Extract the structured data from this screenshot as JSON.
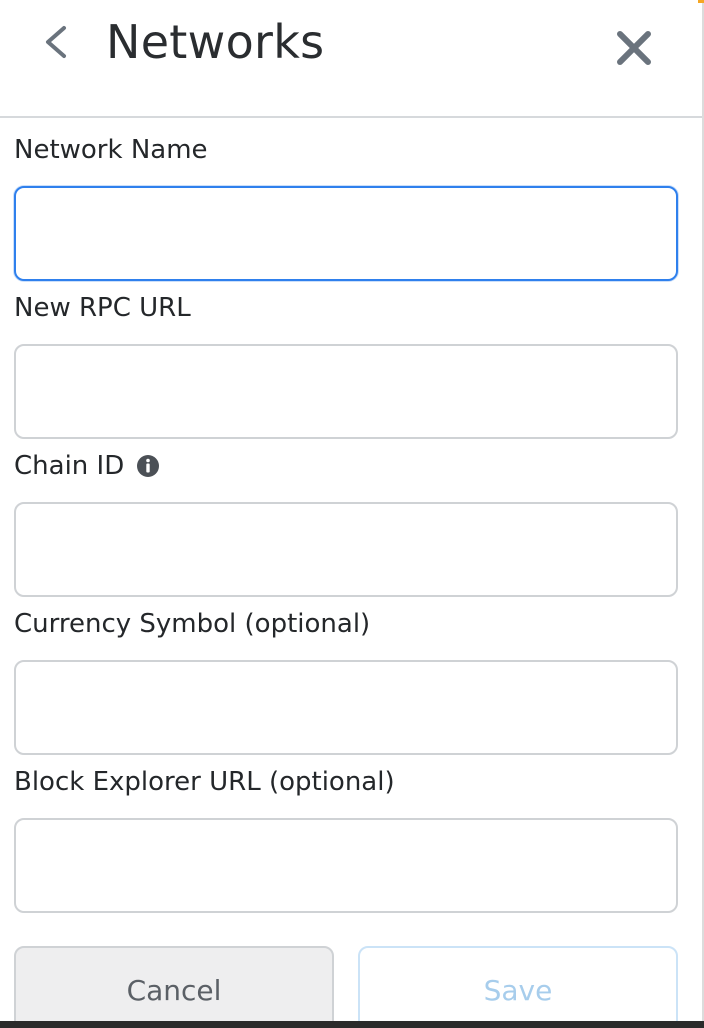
{
  "header": {
    "title": "Networks",
    "back_icon": "chevron-left-icon",
    "close_icon": "close-icon"
  },
  "form": {
    "network_name": {
      "label": "Network Name",
      "value": "",
      "placeholder": ""
    },
    "rpc_url": {
      "label": "New RPC URL",
      "value": "",
      "placeholder": ""
    },
    "chain_id": {
      "label": "Chain ID",
      "value": "",
      "placeholder": "",
      "info_icon": "info-icon"
    },
    "currency_symbol": {
      "label": "Currency Symbol (optional)",
      "value": "",
      "placeholder": ""
    },
    "block_explorer": {
      "label": "Block Explorer URL (optional)",
      "value": "",
      "placeholder": ""
    }
  },
  "actions": {
    "cancel_label": "Cancel",
    "save_label": "Save"
  },
  "colors": {
    "focus_border": "#2f80ed",
    "save_text_disabled": "#a7cdec",
    "cancel_bg": "#eeeeef"
  }
}
